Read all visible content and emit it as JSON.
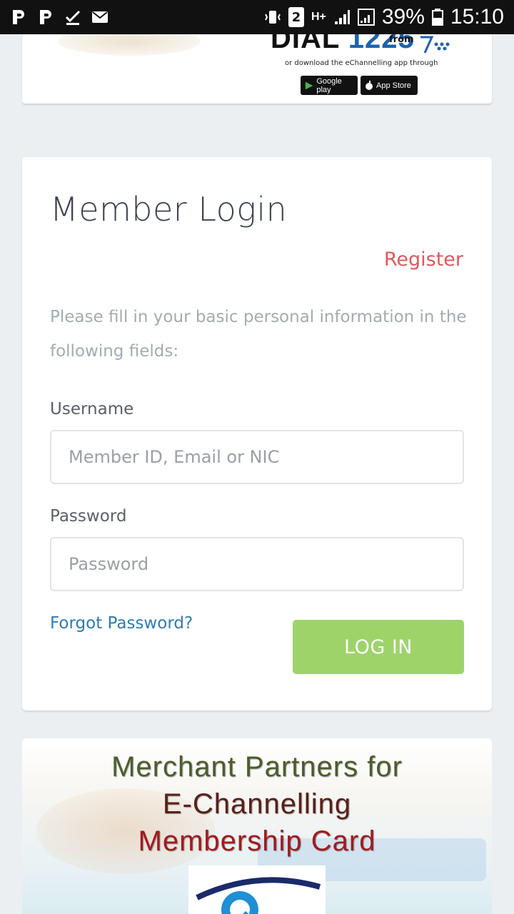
{
  "status_bar": {
    "battery": "39%",
    "time": "15:10",
    "sim_slot": "2",
    "network": "H+"
  },
  "ad_banner": {
    "dial_prefix": "DIAL",
    "dial_number": "1225",
    "from": "from",
    "download_text": "or download the eChannelling app through",
    "google_play": "Google play",
    "app_store": "App Store"
  },
  "login": {
    "title": "Member Login",
    "register": "Register",
    "description": "Please fill in your basic personal information in the following fields:",
    "username_label": "Username",
    "username_placeholder": "Member ID, Email or NIC",
    "password_label": "Password",
    "password_placeholder": "Password",
    "forgot": "Forgot Password?",
    "login_button": "LOG IN"
  },
  "promo": {
    "line1": "Merchant Partners for",
    "line2": "E-Channelling",
    "line3": "Membership Card"
  },
  "colors": {
    "accent_green": "#9ed36a",
    "register_red": "#e0585b",
    "link_blue": "#2e7bb4"
  }
}
